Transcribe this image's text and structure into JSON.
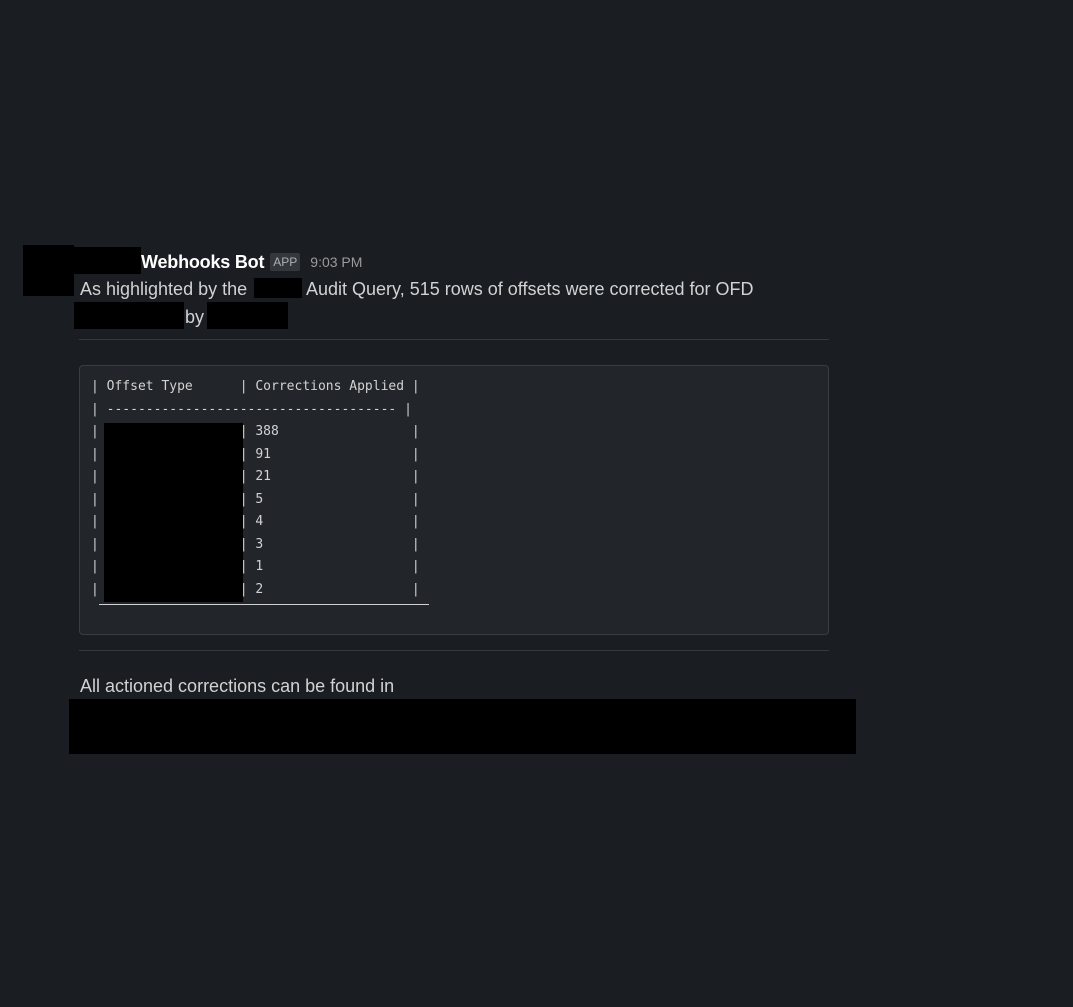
{
  "message": {
    "sender": "Webhooks Bot",
    "badge": "APP",
    "time": "9:03 PM",
    "line1_part1": "As highlighted by the",
    "line1_part2": "Audit Query, 515 rows of offsets were corrected for OFD",
    "line2_by": "by",
    "footer": "All actioned corrections can be found in"
  },
  "table": {
    "header": "| Offset Type      | Corrections Applied |",
    "separator": "| ------------------------------------- |",
    "rows": [
      "|                  | 388                 |",
      "|                  | 91                  |",
      "|                  | 21                  |",
      "|                  | 5                   |",
      "|                  | 4                   |",
      "|                  | 3                   |",
      "|                  | 1                   |",
      "|                  | 2                   |"
    ],
    "values": [
      388,
      91,
      21,
      5,
      4,
      3,
      1,
      2
    ]
  },
  "colors": {
    "background": "#1a1d21",
    "text": "#d1d2d3",
    "code_background": "#222529",
    "redaction": "#000000"
  }
}
